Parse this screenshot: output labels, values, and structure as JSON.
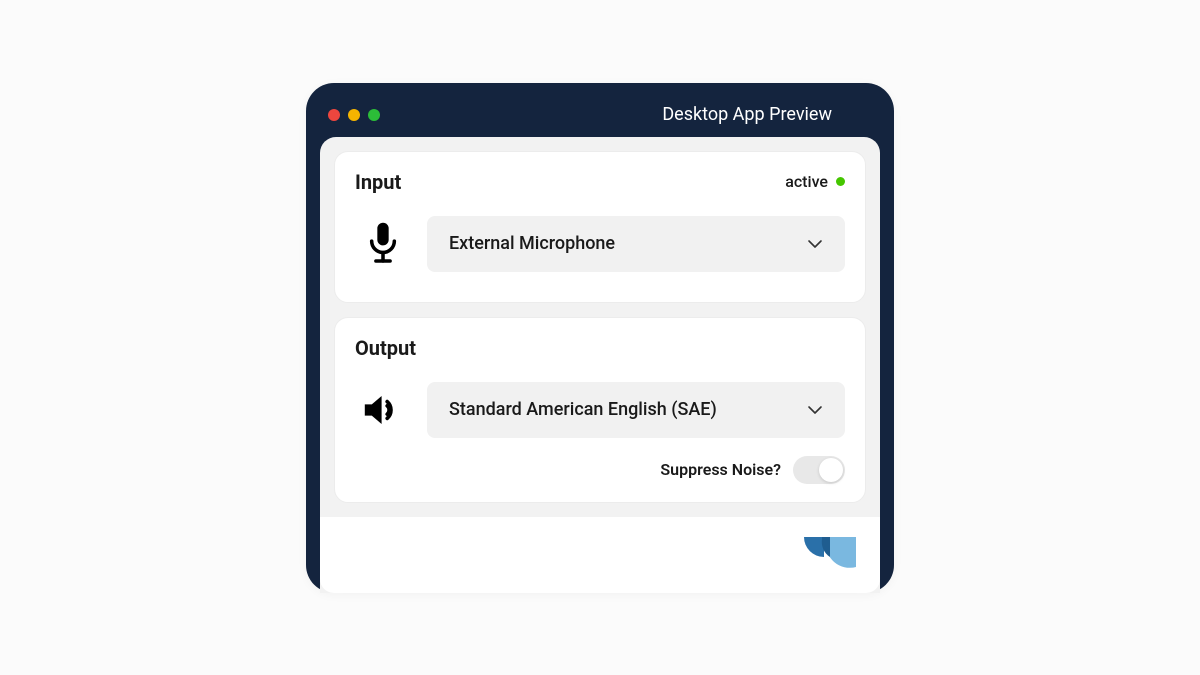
{
  "window": {
    "title": "Desktop App Preview"
  },
  "input": {
    "title": "Input",
    "status_label": "active",
    "device_selected": "External Microphone"
  },
  "output": {
    "title": "Output",
    "voice_selected": "Standard American English (SAE)",
    "suppress_label": "Suppress Noise?",
    "suppress_enabled": false
  }
}
